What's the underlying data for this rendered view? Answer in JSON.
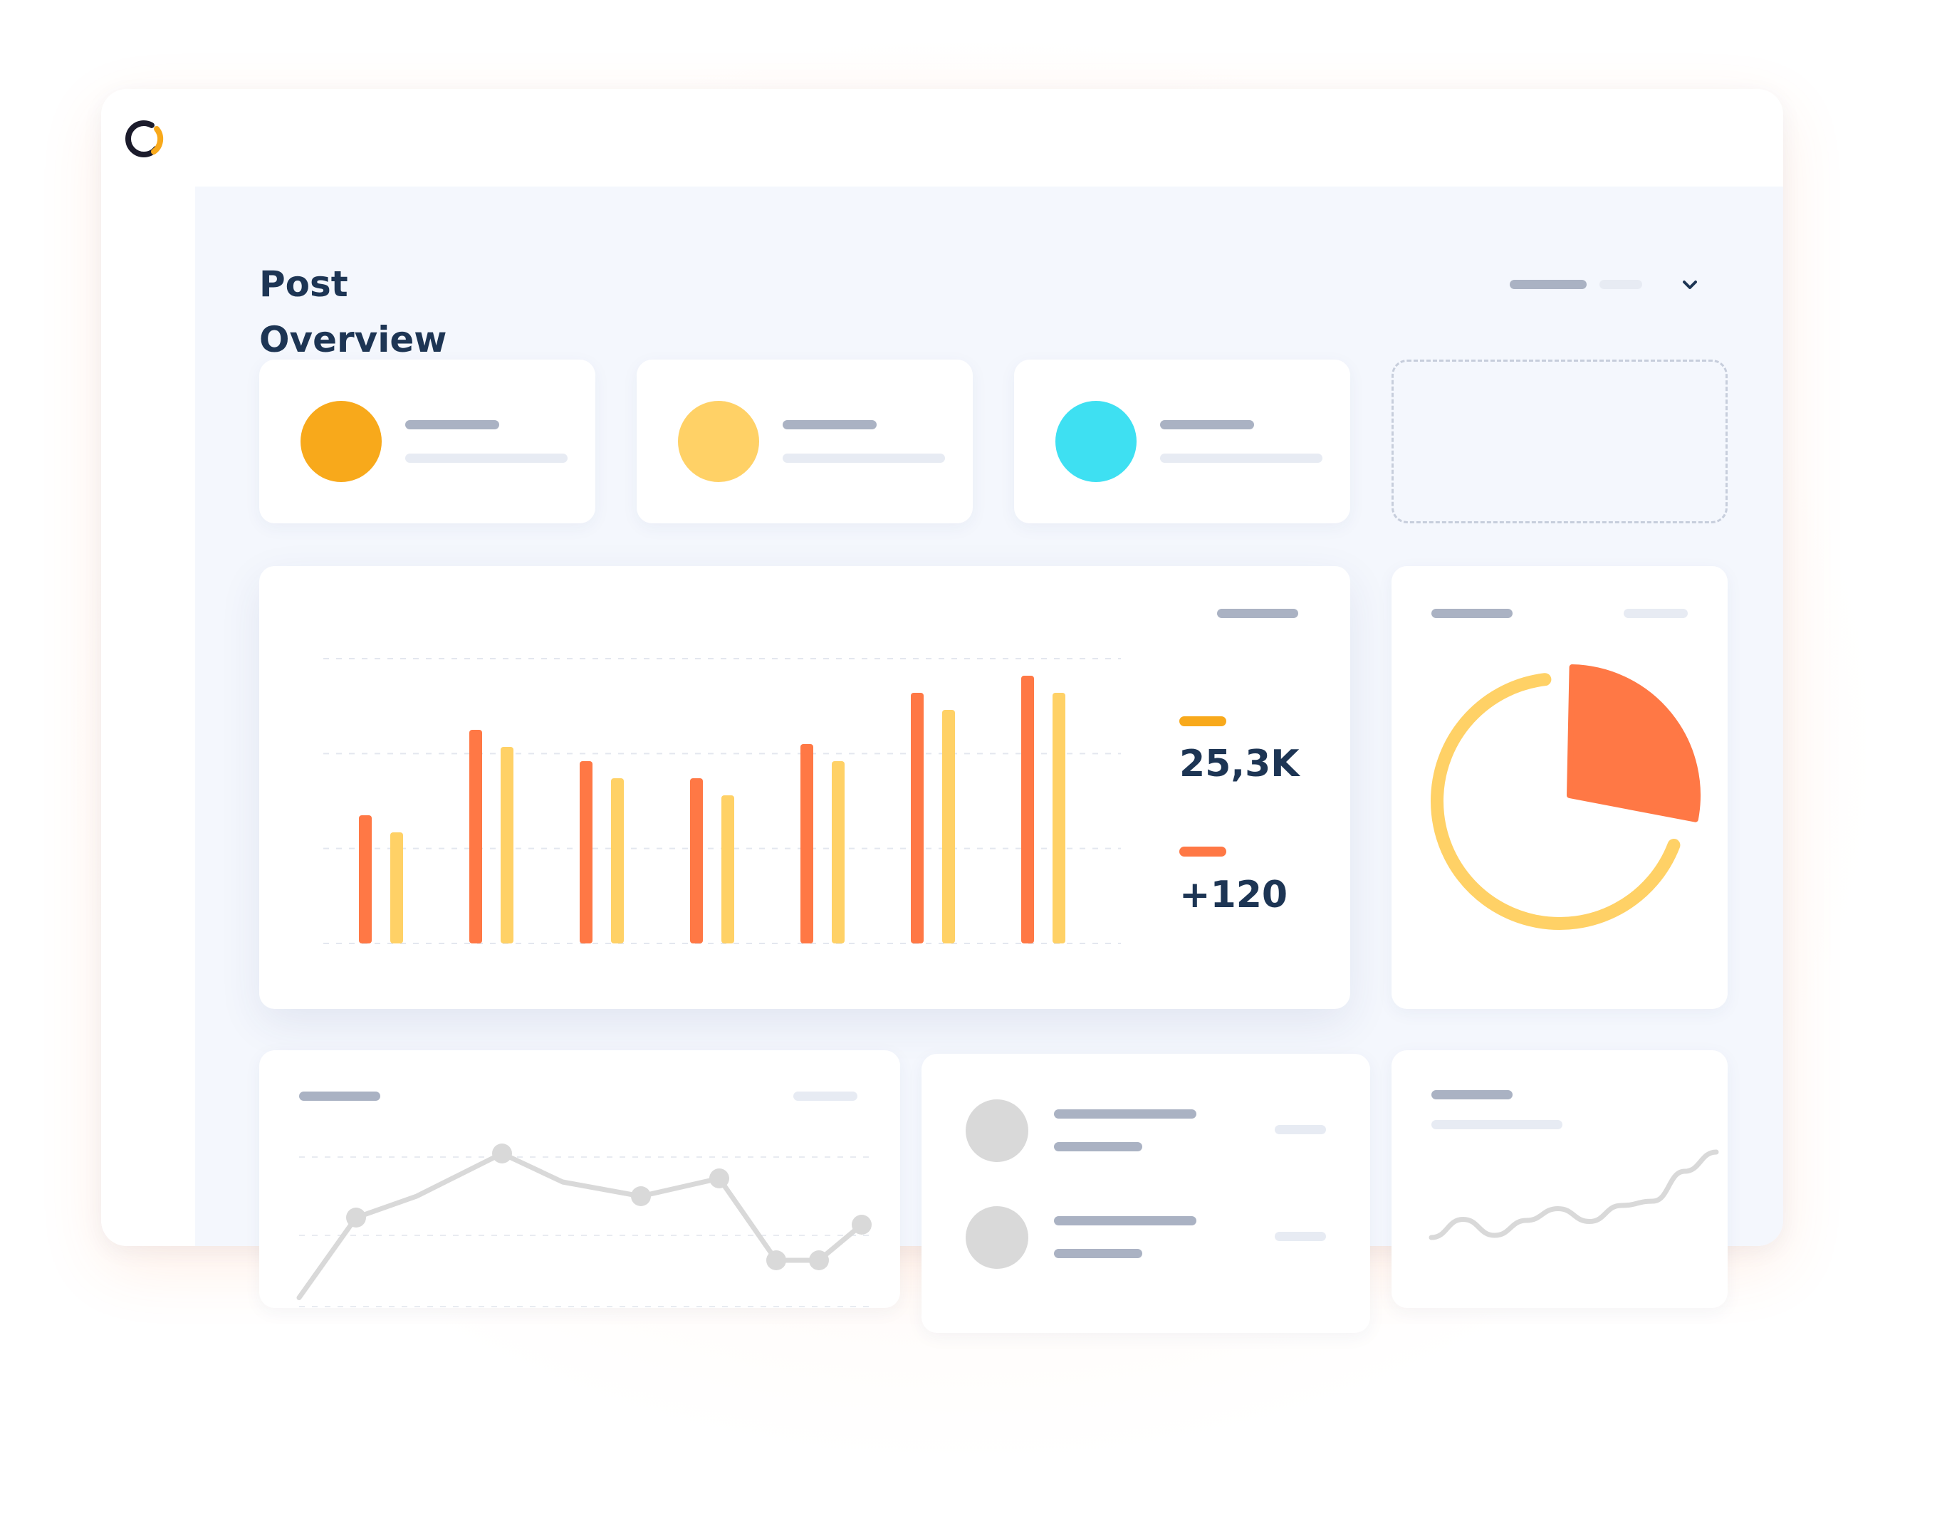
{
  "page": {
    "title_line1": "Post",
    "title_line2": "Overview"
  },
  "icons": {
    "logo": "logo-ring-icon",
    "period_dropdown": "chevron-down-icon"
  },
  "colors": {
    "accent_orange": "#ff7845",
    "accent_amber": "#f8a91b",
    "accent_yellow": "#ffd166",
    "accent_cyan": "#3ee0f2",
    "text_dark": "#1d3554",
    "placeholder_gray": "#aab2c3",
    "placeholder_light": "#e7ebf3"
  },
  "stat_cards": [
    {
      "color": "#f8a91b"
    },
    {
      "color": "#ffd166"
    },
    {
      "color": "#3ee0f2"
    }
  ],
  "metrics": [
    {
      "value": "25,3K",
      "color": "#f8a91b"
    },
    {
      "value": "+120",
      "color": "#ff7845"
    }
  ],
  "chart_data": [
    {
      "type": "bar",
      "categories": [
        "",
        "",
        "",
        "",
        "",
        "",
        ""
      ],
      "ylim": [
        0,
        100
      ],
      "grid": true,
      "series": [
        {
          "color": "#ff7845",
          "values": [
            45,
            75,
            64,
            58,
            70,
            88,
            94
          ]
        },
        {
          "color": "#ffd166",
          "values": [
            39,
            69,
            58,
            52,
            64,
            82,
            88
          ]
        }
      ]
    },
    {
      "type": "pie",
      "slices": [
        {
          "value": 28,
          "color": "#ff7845",
          "exploded": true
        },
        {
          "value": 72,
          "color": "#ffd166",
          "style": "ring"
        }
      ]
    },
    {
      "type": "line",
      "ylim": [
        0,
        100
      ],
      "grid": true,
      "series": [
        {
          "color": "#d9d9d9",
          "values": [
            5,
            50,
            62,
            86,
            70,
            62,
            72,
            26,
            26,
            46
          ],
          "markers": [
            false,
            true,
            false,
            true,
            false,
            true,
            true,
            true,
            true,
            true
          ]
        }
      ]
    },
    {
      "type": "line",
      "ylim": [
        0,
        100
      ],
      "series": [
        {
          "color": "#d9d9d9",
          "values": [
            18,
            35,
            20,
            34,
            45,
            33,
            48,
            52,
            80,
            98
          ],
          "smooth": true
        }
      ]
    }
  ]
}
